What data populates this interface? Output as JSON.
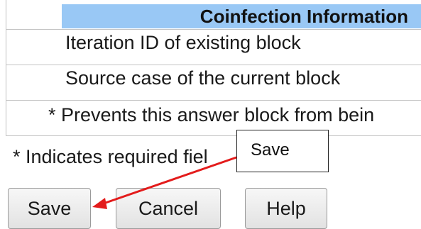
{
  "section": {
    "title": "Coinfection Information"
  },
  "rows": {
    "iteration_id": "Iteration ID of existing block",
    "source_case": "Source case of the current block",
    "prevents_note": "* Prevents this answer block from bein"
  },
  "footer": {
    "required_note": "* Indicates required fiel"
  },
  "buttons": {
    "save": "Save",
    "cancel": "Cancel",
    "help": "Help"
  },
  "callout": {
    "text": "Save"
  },
  "colors": {
    "header_bg": "#99c8f5",
    "arrow": "#e31b1b"
  }
}
